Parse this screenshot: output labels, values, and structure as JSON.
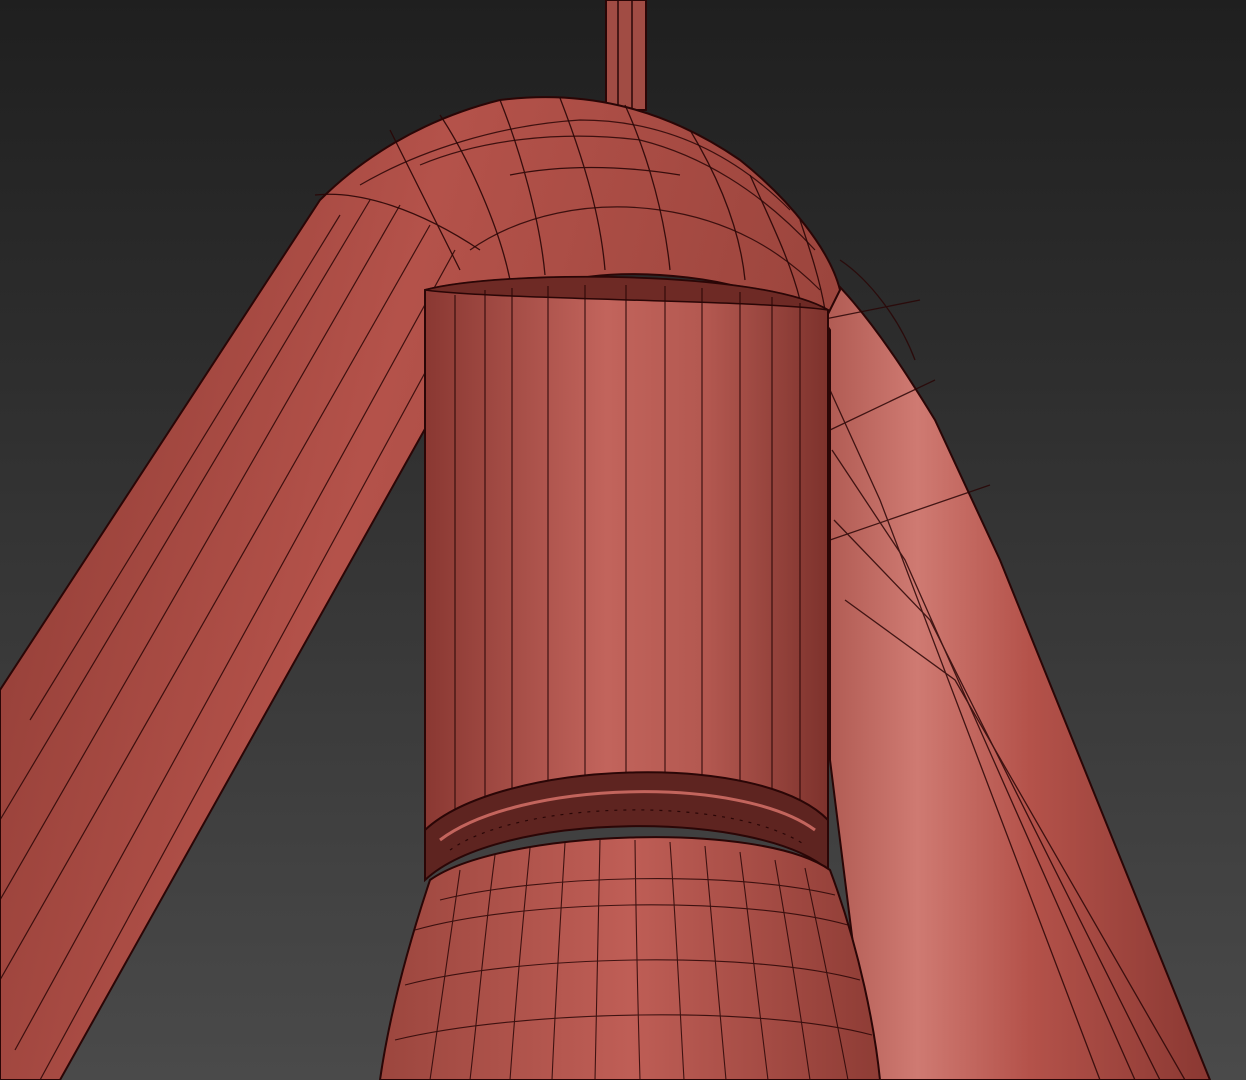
{
  "viewport": {
    "background_top": "#1f1f1f",
    "background_bottom": "#4a4a4a",
    "shading": "wireframe-on-shaded"
  },
  "model": {
    "base_color": "#b4524a",
    "highlight_color": "#d7827a",
    "shadow_color": "#6e2a25",
    "wire_color": "#2a0606",
    "parts": [
      "hanging-rod",
      "curved-tube-frame",
      "cylindrical-housing",
      "neck-ring",
      "lamp-shade"
    ]
  }
}
